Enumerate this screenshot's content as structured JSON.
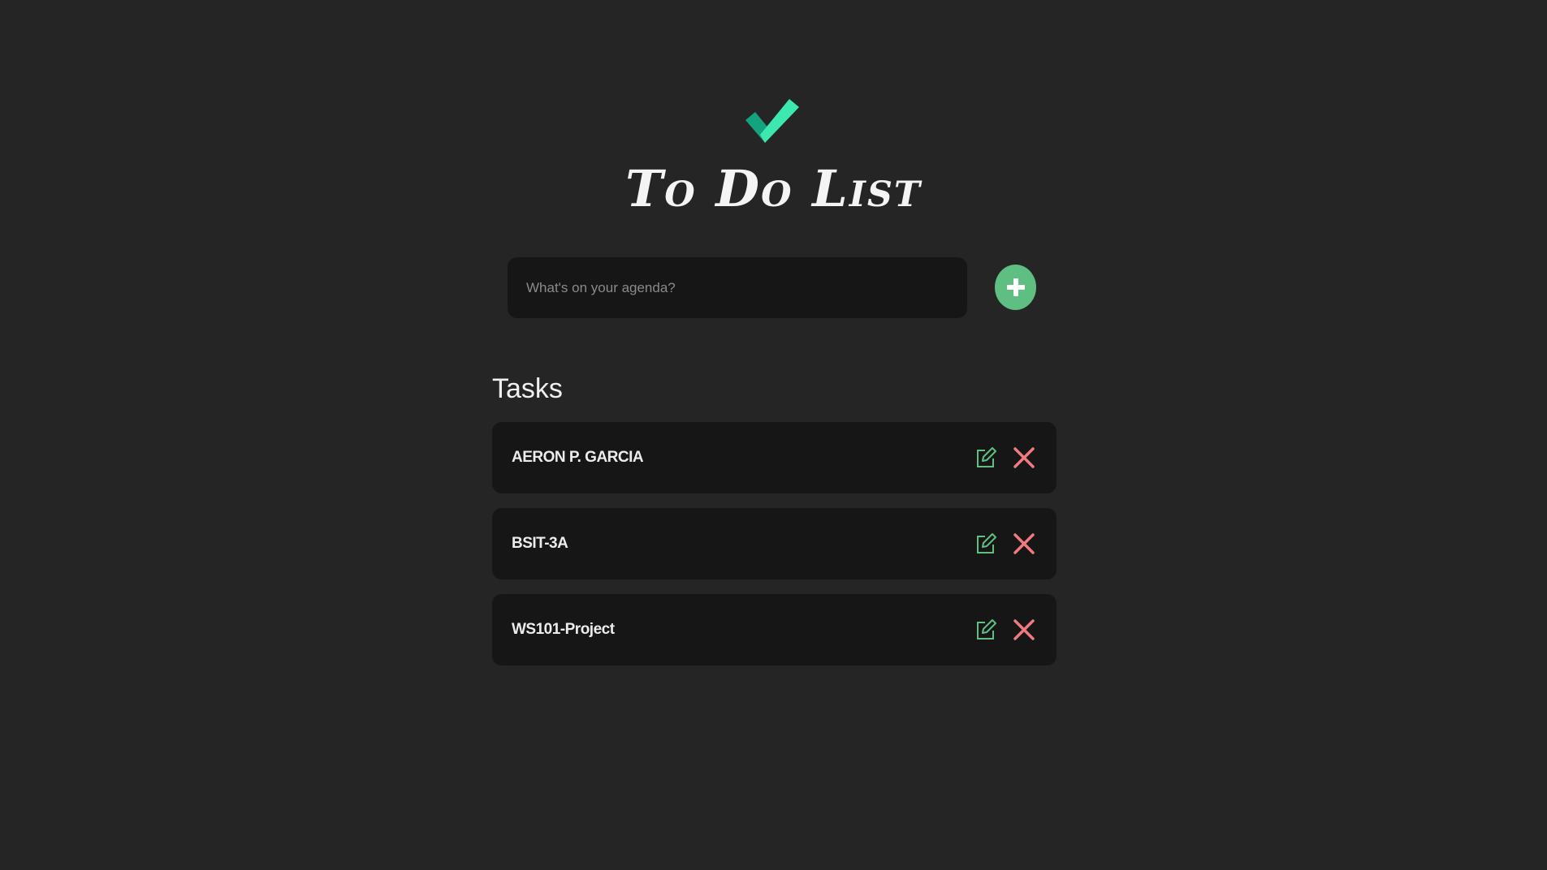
{
  "header": {
    "logo_icon": "checkmark-icon",
    "title": "To Do List"
  },
  "new_task": {
    "value": "",
    "placeholder": "What's on your agenda?",
    "add_icon": "plus-icon"
  },
  "tasks_heading": "Tasks",
  "tasks": [
    {
      "label": "AERON P. GARCIA",
      "edit_icon": "edit-icon",
      "delete_icon": "close-icon"
    },
    {
      "label": "BSIT-3A",
      "edit_icon": "edit-icon",
      "delete_icon": "close-icon"
    },
    {
      "label": "WS101-Project",
      "edit_icon": "edit-icon",
      "delete_icon": "close-icon"
    }
  ],
  "colors": {
    "background": "#252525",
    "card": "#161616",
    "accent_green": "#5fbf82",
    "delete_red": "#f07a80",
    "logo_green_dark": "#14a37f",
    "logo_green_light": "#3de8b0"
  }
}
